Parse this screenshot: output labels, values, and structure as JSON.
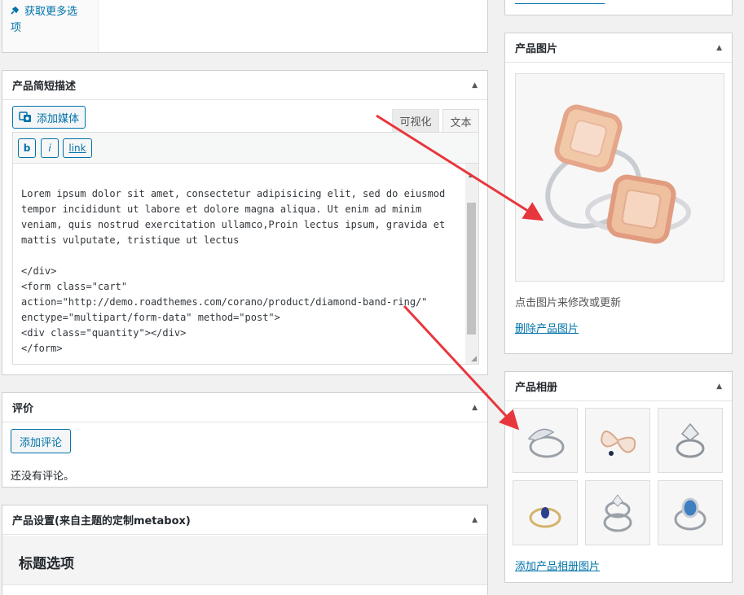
{
  "get_more": {
    "label": "获取更多选\n项"
  },
  "short_desc": {
    "title": "产品简短描述",
    "add_media": "添加媒体",
    "tab_visual": "可视化",
    "tab_text": "文本",
    "qt_b": "b",
    "qt_i": "i",
    "qt_link": "link",
    "content": "Lorem ipsum dolor sit amet, consectetur adipisicing elit, sed do eiusmod\ntempor incididunt ut labore et dolore magna aliqua. Ut enim ad minim\nveniam, quis nostrud exercitation ullamco,Proin lectus ipsum, gravida et\nmattis vulputate, tristique ut lectus\n\n</div>\n<form class=\"cart\"\naction=\"http://demo.roadthemes.com/corano/product/diamond-band-ring/\"\nenctype=\"multipart/form-data\" method=\"post\">\n<div class=\"quantity\"></div>\n</form>"
  },
  "reviews": {
    "title": "评价",
    "add_button": "添加评论",
    "empty_text": "还没有评论。"
  },
  "product_settings": {
    "title": "产品设置(来自主题的定制metabox)",
    "section_title": "标题选项"
  },
  "product_image": {
    "title": "产品图片",
    "hint": "点击图片来修改或更新",
    "remove_link": "删除产品图片"
  },
  "gallery": {
    "title": "产品相册",
    "add_link": "添加产品相册图片",
    "images": [
      "ring-icon",
      "brooch-icon",
      "ring-icon",
      "ring-icon",
      "ring-icon",
      "ring-icon"
    ]
  },
  "colors": {
    "accent": "#0073aa",
    "arrow": "#e8363d"
  }
}
